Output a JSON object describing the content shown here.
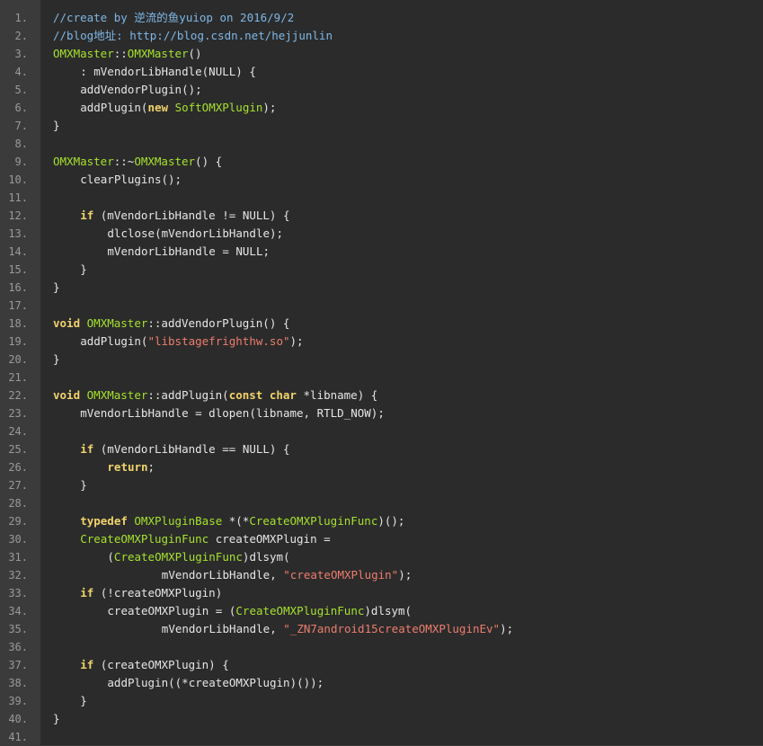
{
  "code_lines": [
    {
      "n": "1.",
      "indent": 0,
      "tokens": [
        {
          "t": "//create by 逆流的鱼yuiop on 2016/9/2",
          "c": "com"
        }
      ]
    },
    {
      "n": "2.",
      "indent": 0,
      "tokens": [
        {
          "t": "//blog地址: http://blog.csdn.net/hejjunlin",
          "c": "com"
        }
      ]
    },
    {
      "n": "3.",
      "indent": 0,
      "tokens": [
        {
          "t": "OMXMaster",
          "c": "cls"
        },
        {
          "t": "::",
          "c": "pl"
        },
        {
          "t": "OMXMaster",
          "c": "cls"
        },
        {
          "t": "()",
          "c": "pl"
        }
      ]
    },
    {
      "n": "4.",
      "indent": 4,
      "tokens": [
        {
          "t": ": mVendorLibHandle(NULL) {",
          "c": "pl"
        }
      ]
    },
    {
      "n": "5.",
      "indent": 4,
      "tokens": [
        {
          "t": "addVendorPlugin();",
          "c": "pl"
        }
      ]
    },
    {
      "n": "6.",
      "indent": 4,
      "tokens": [
        {
          "t": "addPlugin(",
          "c": "pl"
        },
        {
          "t": "new",
          "c": "kw"
        },
        {
          "t": " ",
          "c": "pl"
        },
        {
          "t": "SoftOMXPlugin",
          "c": "cls"
        },
        {
          "t": ");",
          "c": "pl"
        }
      ]
    },
    {
      "n": "7.",
      "indent": 0,
      "tokens": [
        {
          "t": "}",
          "c": "pl"
        }
      ]
    },
    {
      "n": "8.",
      "indent": 0,
      "tokens": []
    },
    {
      "n": "9.",
      "indent": 0,
      "tokens": [
        {
          "t": "OMXMaster",
          "c": "cls"
        },
        {
          "t": "::~",
          "c": "pl"
        },
        {
          "t": "OMXMaster",
          "c": "cls"
        },
        {
          "t": "() {",
          "c": "pl"
        }
      ]
    },
    {
      "n": "10.",
      "indent": 4,
      "tokens": [
        {
          "t": "clearPlugins();",
          "c": "pl"
        }
      ]
    },
    {
      "n": "11.",
      "indent": 0,
      "tokens": []
    },
    {
      "n": "12.",
      "indent": 4,
      "tokens": [
        {
          "t": "if",
          "c": "kw"
        },
        {
          "t": " (mVendorLibHandle != NULL) {",
          "c": "pl"
        }
      ]
    },
    {
      "n": "13.",
      "indent": 8,
      "tokens": [
        {
          "t": "dlclose(mVendorLibHandle);",
          "c": "pl"
        }
      ]
    },
    {
      "n": "14.",
      "indent": 8,
      "tokens": [
        {
          "t": "mVendorLibHandle = NULL;",
          "c": "pl"
        }
      ]
    },
    {
      "n": "15.",
      "indent": 4,
      "tokens": [
        {
          "t": "}",
          "c": "pl"
        }
      ]
    },
    {
      "n": "16.",
      "indent": 0,
      "tokens": [
        {
          "t": "}",
          "c": "pl"
        }
      ]
    },
    {
      "n": "17.",
      "indent": 0,
      "tokens": []
    },
    {
      "n": "18.",
      "indent": 0,
      "tokens": [
        {
          "t": "void",
          "c": "kw"
        },
        {
          "t": " ",
          "c": "pl"
        },
        {
          "t": "OMXMaster",
          "c": "cls"
        },
        {
          "t": "::addVendorPlugin() {",
          "c": "pl"
        }
      ]
    },
    {
      "n": "19.",
      "indent": 4,
      "tokens": [
        {
          "t": "addPlugin(",
          "c": "pl"
        },
        {
          "t": "\"libstagefrighthw.so\"",
          "c": "str"
        },
        {
          "t": ");",
          "c": "pl"
        }
      ]
    },
    {
      "n": "20.",
      "indent": 0,
      "tokens": [
        {
          "t": "}",
          "c": "pl"
        }
      ]
    },
    {
      "n": "21.",
      "indent": 0,
      "tokens": []
    },
    {
      "n": "22.",
      "indent": 0,
      "tokens": [
        {
          "t": "void",
          "c": "kw"
        },
        {
          "t": " ",
          "c": "pl"
        },
        {
          "t": "OMXMaster",
          "c": "cls"
        },
        {
          "t": "::addPlugin(",
          "c": "pl"
        },
        {
          "t": "const",
          "c": "kw"
        },
        {
          "t": " ",
          "c": "pl"
        },
        {
          "t": "char",
          "c": "kw"
        },
        {
          "t": " *libname) {",
          "c": "pl"
        }
      ]
    },
    {
      "n": "23.",
      "indent": 4,
      "tokens": [
        {
          "t": "mVendorLibHandle = dlopen(libname, RTLD_NOW);",
          "c": "pl"
        }
      ]
    },
    {
      "n": "24.",
      "indent": 0,
      "tokens": []
    },
    {
      "n": "25.",
      "indent": 4,
      "tokens": [
        {
          "t": "if",
          "c": "kw"
        },
        {
          "t": " (mVendorLibHandle == NULL) {",
          "c": "pl"
        }
      ]
    },
    {
      "n": "26.",
      "indent": 8,
      "tokens": [
        {
          "t": "return",
          "c": "kw"
        },
        {
          "t": ";",
          "c": "pl"
        }
      ]
    },
    {
      "n": "27.",
      "indent": 4,
      "tokens": [
        {
          "t": "}",
          "c": "pl"
        }
      ]
    },
    {
      "n": "28.",
      "indent": 0,
      "tokens": []
    },
    {
      "n": "29.",
      "indent": 4,
      "tokens": [
        {
          "t": "typedef",
          "c": "kw"
        },
        {
          "t": " ",
          "c": "pl"
        },
        {
          "t": "OMXPluginBase",
          "c": "cls"
        },
        {
          "t": " *(*",
          "c": "pl"
        },
        {
          "t": "CreateOMXPluginFunc",
          "c": "cls"
        },
        {
          "t": ")();",
          "c": "pl"
        }
      ]
    },
    {
      "n": "30.",
      "indent": 4,
      "tokens": [
        {
          "t": "CreateOMXPluginFunc",
          "c": "cls"
        },
        {
          "t": " createOMXPlugin =",
          "c": "pl"
        }
      ]
    },
    {
      "n": "31.",
      "indent": 8,
      "tokens": [
        {
          "t": "(",
          "c": "pl"
        },
        {
          "t": "CreateOMXPluginFunc",
          "c": "cls"
        },
        {
          "t": ")dlsym(",
          "c": "pl"
        }
      ]
    },
    {
      "n": "32.",
      "indent": 16,
      "tokens": [
        {
          "t": "mVendorLibHandle, ",
          "c": "pl"
        },
        {
          "t": "\"createOMXPlugin\"",
          "c": "str"
        },
        {
          "t": ");",
          "c": "pl"
        }
      ]
    },
    {
      "n": "33.",
      "indent": 4,
      "tokens": [
        {
          "t": "if",
          "c": "kw"
        },
        {
          "t": " (!createOMXPlugin)",
          "c": "pl"
        }
      ]
    },
    {
      "n": "34.",
      "indent": 8,
      "tokens": [
        {
          "t": "createOMXPlugin = (",
          "c": "pl"
        },
        {
          "t": "CreateOMXPluginFunc",
          "c": "cls"
        },
        {
          "t": ")dlsym(",
          "c": "pl"
        }
      ]
    },
    {
      "n": "35.",
      "indent": 16,
      "tokens": [
        {
          "t": "mVendorLibHandle, ",
          "c": "pl"
        },
        {
          "t": "\"_ZN7android15createOMXPluginEv\"",
          "c": "str"
        },
        {
          "t": ");",
          "c": "pl"
        }
      ]
    },
    {
      "n": "36.",
      "indent": 0,
      "tokens": []
    },
    {
      "n": "37.",
      "indent": 4,
      "tokens": [
        {
          "t": "if",
          "c": "kw"
        },
        {
          "t": " (createOMXPlugin) {",
          "c": "pl"
        }
      ]
    },
    {
      "n": "38.",
      "indent": 8,
      "tokens": [
        {
          "t": "addPlugin((*createOMXPlugin)());",
          "c": "pl"
        }
      ]
    },
    {
      "n": "39.",
      "indent": 4,
      "tokens": [
        {
          "t": "}",
          "c": "pl"
        }
      ]
    },
    {
      "n": "40.",
      "indent": 0,
      "tokens": [
        {
          "t": "}",
          "c": "pl"
        }
      ]
    },
    {
      "n": "41.",
      "indent": 0,
      "tokens": []
    }
  ],
  "colors": {
    "background": "#2b2b2b",
    "gutter": "#3b3b3b",
    "line_number": "#9a9a9a",
    "comment": "#7fb7e6",
    "class_name": "#a6e22e",
    "keyword": "#f2d36b",
    "string": "#ee7d6e",
    "plain": "#e6e6e6"
  }
}
